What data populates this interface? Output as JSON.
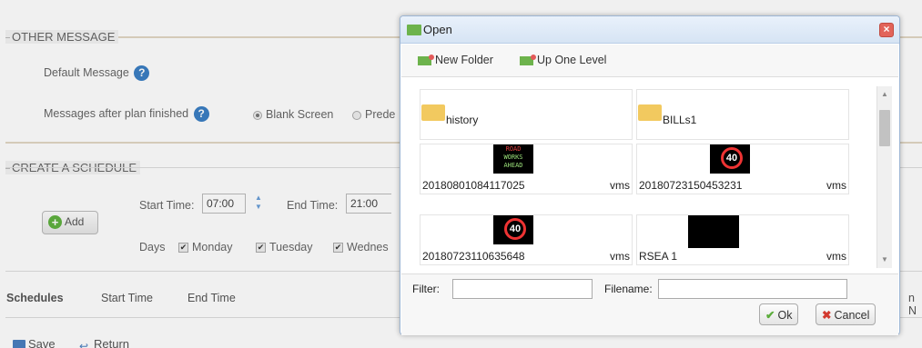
{
  "other_message": {
    "legend": "OTHER MESSAGE",
    "default_message_label": "Default Message",
    "after_plan_label": "Messages after plan finished",
    "options": [
      {
        "label": "Blank Screen",
        "selected": true
      },
      {
        "label": "Prede",
        "selected": false
      }
    ]
  },
  "schedule": {
    "legend": "CREATE A SCHEDULE",
    "start_time_label": "Start Time:",
    "start_time_value": "07:00",
    "end_time_label": "End Time:",
    "end_time_value": "21:00",
    "add_label": "Add",
    "days_label": "Days",
    "days": [
      {
        "label": "Monday",
        "checked": true
      },
      {
        "label": "Tuesday",
        "checked": true
      },
      {
        "label": "Wednes",
        "checked": true
      }
    ]
  },
  "schedules_table": {
    "headers": [
      "Schedules",
      "Start Time",
      "End Time"
    ],
    "cut_header": "n N"
  },
  "footer": {
    "save_label": "Save",
    "return_label": "Return"
  },
  "dialog": {
    "title": "Open",
    "toolbar": {
      "new_folder": "New Folder",
      "up_one_level": "Up One Level"
    },
    "files": [
      {
        "name": "history",
        "type": "",
        "kind": "folder"
      },
      {
        "name": "BILLs1",
        "type": "",
        "kind": "folder"
      },
      {
        "name": "20180801084117025",
        "type": "vms",
        "kind": "roadworks"
      },
      {
        "name": "20180723150453231",
        "type": "vms",
        "kind": "sign40"
      },
      {
        "name": "20180723110635648",
        "type": "vms",
        "kind": "sign40"
      },
      {
        "name": "RSEA 1",
        "type": "vms",
        "kind": "blank"
      }
    ],
    "thumb_text": {
      "line1": "ROAD",
      "line2": "WORKS",
      "line3": "AHEAD",
      "sign": "40"
    },
    "filter_label": "Filter:",
    "filter_value": "",
    "filename_label": "Filename:",
    "filename_value": "",
    "ok_label": "Ok",
    "cancel_label": "Cancel"
  }
}
